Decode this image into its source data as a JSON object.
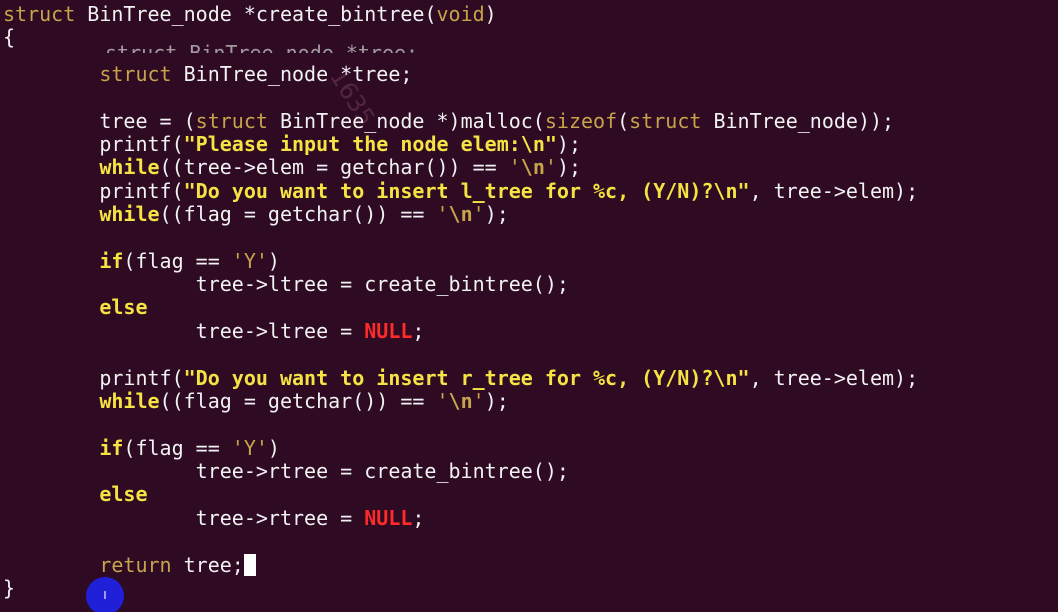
{
  "code": {
    "l1": {
      "kw": "struct",
      "rest": " BinTree_node *create_bintree(",
      "param": "void",
      "close": ")"
    },
    "l2": {
      "text": "{"
    },
    "l3": {
      "indent": "        ",
      "kw": "struct",
      "rest": " BinTree_node *tree;"
    },
    "l4": {
      "indent": "        ",
      "pre": "tree = (",
      "kw1": "struct",
      "mid1": " BinTree_node *)malloc(",
      "kw2": "sizeof",
      "mid2": "(",
      "kw3": "struct",
      "end": " BinTree_node));"
    },
    "l5": {
      "indent": "        ",
      "pre": "printf(",
      "str": "\"Please input the node elem:\\n\"",
      "end": ");"
    },
    "l6": {
      "indent": "        ",
      "kw": "while",
      "mid": "((tree->elem = getchar()) == ",
      "lit1": "'",
      "esc": "\\n",
      "lit2": "'",
      "end": ");"
    },
    "l7": {
      "indent": "        ",
      "pre": "printf(",
      "str": "\"Do you want to insert l_tree for %c, (Y/N)?\\n\"",
      "end": ", tree->elem);"
    },
    "l8": {
      "indent": "        ",
      "kw": "while",
      "mid": "((flag = getchar()) == ",
      "lit1": "'",
      "esc": "\\n",
      "lit2": "'",
      "end": ");"
    },
    "l9": {
      "indent": "        ",
      "kw": "if",
      "mid": "(flag == ",
      "lit": "'Y'",
      "end": ")"
    },
    "l10": {
      "indent": "                ",
      "text": "tree->ltree = create_bintree();"
    },
    "l11": {
      "indent": "        ",
      "kw": "else"
    },
    "l12": {
      "indent": "                ",
      "pre": "tree->ltree = ",
      "null": "NULL",
      "end": ";"
    },
    "l13": {
      "indent": "        ",
      "pre": "printf(",
      "str": "\"Do you want to insert r_tree for %c, (Y/N)?\\n\"",
      "end": ", tree->elem);"
    },
    "l14": {
      "indent": "        ",
      "kw": "while",
      "mid": "((flag = getchar()) == ",
      "lit1": "'",
      "esc": "\\n",
      "lit2": "'",
      "end": ");"
    },
    "l15": {
      "indent": "        ",
      "kw": "if",
      "mid": "(flag == ",
      "lit": "'Y'",
      "end": ")"
    },
    "l16": {
      "indent": "                ",
      "text": "tree->rtree = create_bintree();"
    },
    "l17": {
      "indent": "        ",
      "kw": "else"
    },
    "l18": {
      "indent": "                ",
      "pre": "tree->rtree = ",
      "null": "NULL",
      "end": ";"
    },
    "l19": {
      "indent": "        ",
      "kw": "return",
      "rest": " tree;"
    },
    "l20": {
      "text": "}"
    }
  },
  "overlap_text": "struct BinTree_node *tree;",
  "watermark_text": "1635",
  "click_marker_label": "I",
  "colors": {
    "background": "#2e0a23",
    "keyword": "#c7a34b",
    "bold_keyword": "#f5e243",
    "string": "#f5e243",
    "null": "#ff2a2a",
    "text": "#f2f2f2",
    "click_marker": "#2020d8"
  }
}
